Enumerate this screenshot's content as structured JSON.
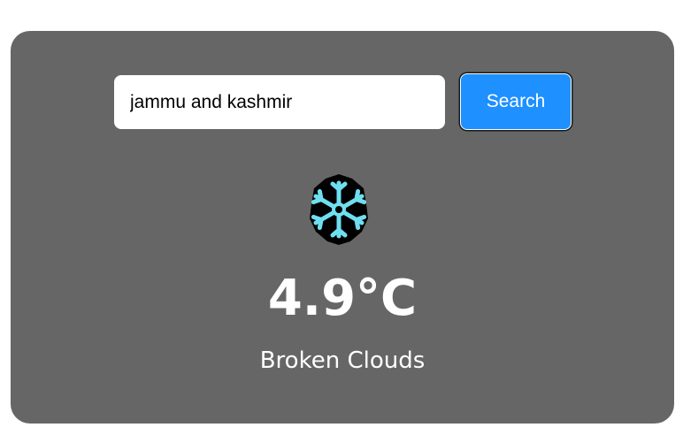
{
  "search": {
    "value": "jammu and kashmir",
    "button_label": "Search"
  },
  "weather": {
    "icon": "snowflake-icon",
    "temperature": "4.9°C",
    "description": "Broken Clouds"
  },
  "colors": {
    "card_background": "#666666",
    "button": "#1e90ff",
    "snowflake": "#6fdff0"
  }
}
